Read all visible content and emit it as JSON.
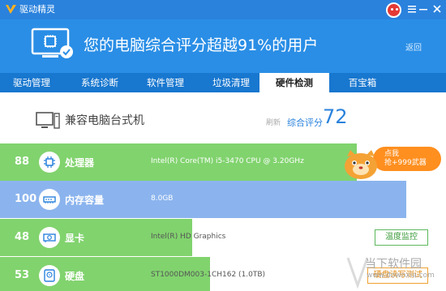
{
  "app": {
    "title": "驱动精灵"
  },
  "banner": {
    "headline": "您的电脑综合评分超越91%的用户",
    "back_label": "返回"
  },
  "tabs": [
    {
      "label": "驱动管理",
      "active": false
    },
    {
      "label": "系统诊断",
      "active": false
    },
    {
      "label": "软件管理",
      "active": false
    },
    {
      "label": "垃圾清理",
      "active": false
    },
    {
      "label": "硬件检测",
      "active": true
    },
    {
      "label": "百宝箱",
      "active": false
    }
  ],
  "computer": {
    "name": "兼容电脑台式机",
    "rescan_label": "刷新",
    "score_label": "综合评分",
    "score": "72"
  },
  "hardware": [
    {
      "score": "88",
      "name": "处理器",
      "detail": "Intel(R) Core(TM) i5-3470 CPU @ 3.20GHz",
      "bar_percent": 80,
      "color": "green",
      "icon": "cpu-icon"
    },
    {
      "score": "100",
      "name": "内存容量",
      "detail": "8.0GB",
      "bar_percent": 91,
      "color": "blue",
      "icon": "memory-icon"
    },
    {
      "score": "48",
      "name": "显卡",
      "detail": "Intel(R) HD Graphics",
      "bar_percent": 43,
      "color": "green",
      "icon": "gpu-icon",
      "action": "温度监控"
    },
    {
      "score": "53",
      "name": "硬盘",
      "detail": "ST1000DM003-1CH162 (1.0TB)",
      "bar_percent": 47,
      "color": "green",
      "icon": "disk-icon",
      "action": "硬盘读写测试"
    }
  ],
  "promo": {
    "line1": "点我",
    "line2": "抢+999武器"
  },
  "watermark": {
    "text": "当下软件园",
    "url": "www.downxia.com"
  },
  "colors": {
    "titlebar": "#2a82dd",
    "banner": "#2a8ee6",
    "tabbar": "#1877cf",
    "green_bar": "#81d36e",
    "blue_bar": "#8bb4ee",
    "score": "#2a82dd",
    "promo": "#ff8f1f"
  }
}
